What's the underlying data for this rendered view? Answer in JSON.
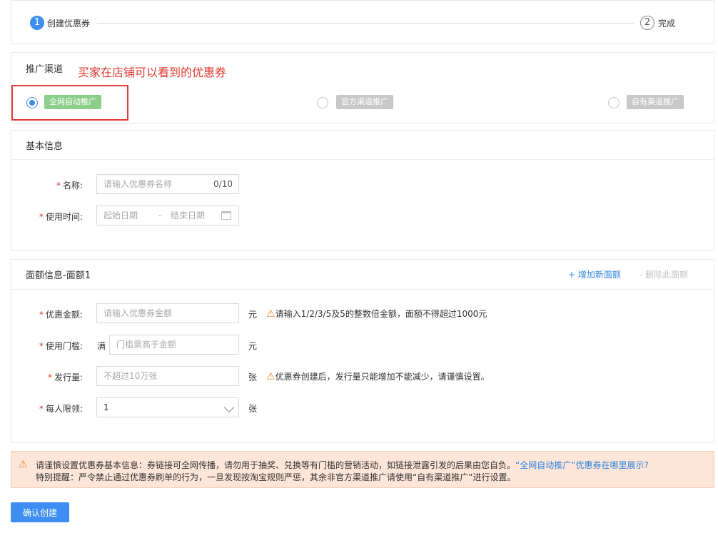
{
  "steps": {
    "step1": {
      "number": "1",
      "label": "创建优惠券"
    },
    "step2": {
      "number": "2",
      "label": "完成"
    }
  },
  "channel": {
    "title": "推广渠道",
    "annotation": "买家在店铺可以看到的优惠券",
    "options": [
      {
        "label": "全网自动推广",
        "selected": true
      },
      {
        "label": "官方渠道推广",
        "selected": false
      },
      {
        "label": "自有渠道推广",
        "selected": false
      }
    ]
  },
  "basic": {
    "title": "基本信息",
    "name_label": "名称:",
    "name_placeholder": "请输入优惠券名称",
    "name_counter": "0/10",
    "time_label": "使用时间:",
    "start_placeholder": "起始日期",
    "separator": "-",
    "end_placeholder": "结束日期"
  },
  "facevalue": {
    "title": "面额信息-面额1",
    "add_link": "+ 增加新面额",
    "delete_link": "- 删除此面额",
    "amount_label": "优惠金额:",
    "amount_placeholder": "请输入优惠券金额",
    "amount_unit": "元",
    "amount_hint": "请输入1/2/3/5及5的整数倍金额，面额不得超过1000元",
    "threshold_label": "使用门槛:",
    "threshold_prefix": "满",
    "threshold_placeholder": "门槛需高于金额",
    "threshold_unit": "元",
    "issue_label": "发行量:",
    "issue_placeholder": "不超过10万张",
    "issue_unit": "张",
    "issue_hint": "优惠券创建后，发行量只能增加不能减少，请谨慎设置。",
    "limit_label": "每人限领:",
    "limit_value": "1",
    "limit_unit": "张"
  },
  "notice": {
    "line1_text": "请谨慎设置优惠券基本信息：券链接可全网传播，请勿用于抽奖、兑换等有门槛的营销活动，如链接泄露引发的后果由您自负。",
    "line1_link": "“全网自动推广”优惠券在哪里展示?",
    "line2_text": "特别提醒：严令禁止通过优惠券刷单的行为，一旦发现按淘宝规则严惩，其余非官方渠道推广请使用“自有渠道推广”进行设置。"
  },
  "submit_label": "确认创建",
  "colors": {
    "accent": "#3d8ef0",
    "warning": "#e8862c",
    "annotation": "#e0392e",
    "notice_bg": "#fde5d8"
  }
}
